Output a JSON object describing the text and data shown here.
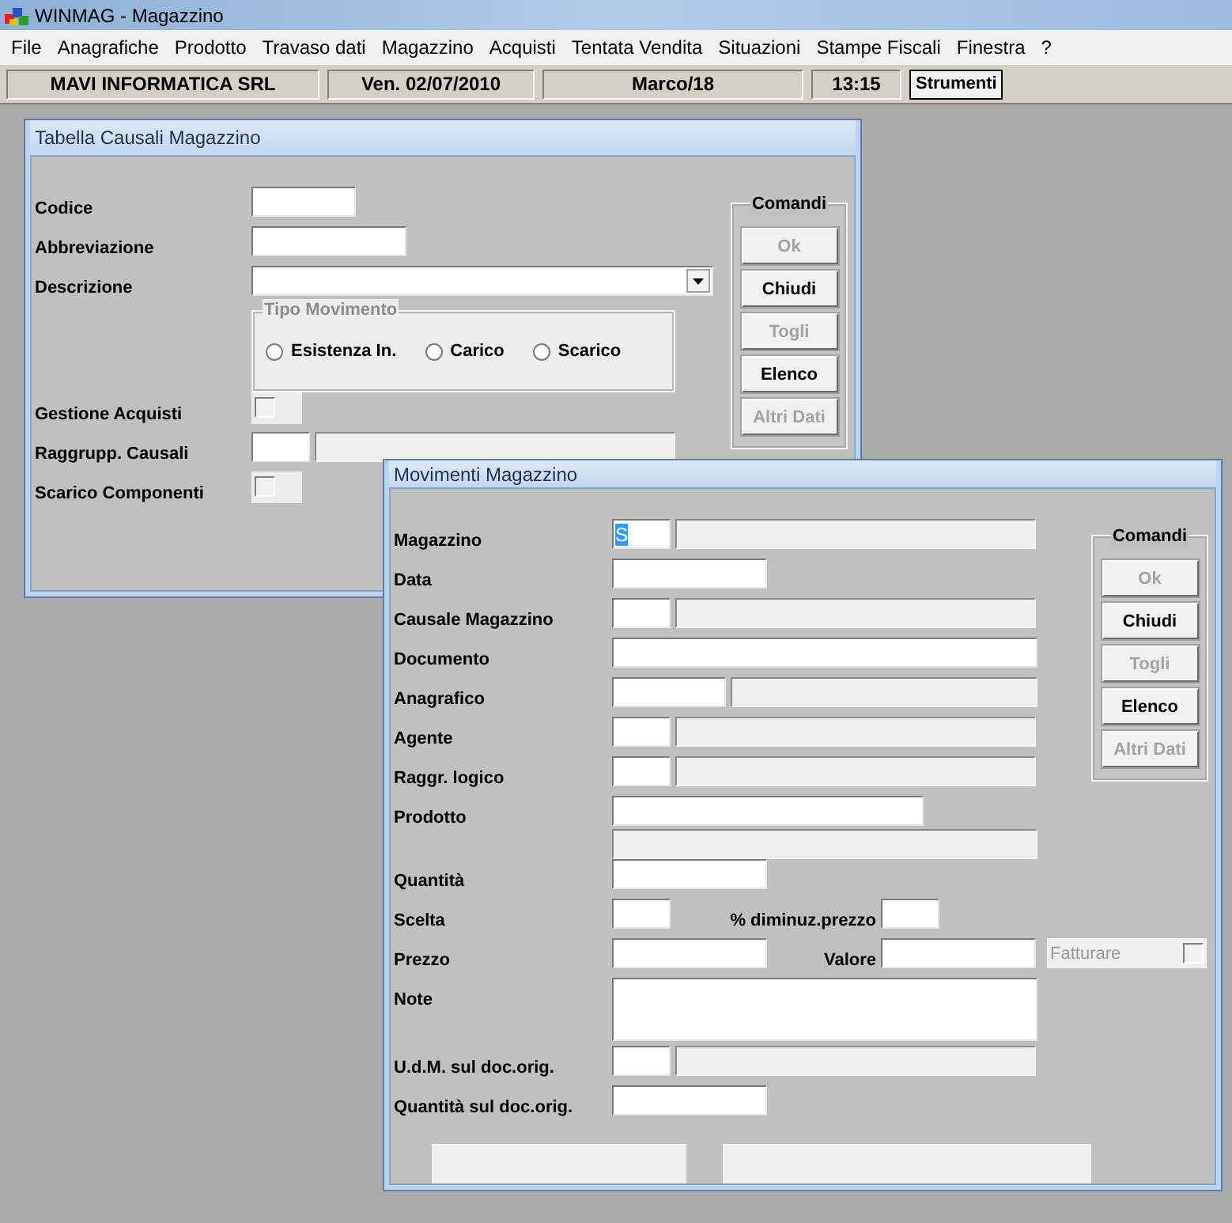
{
  "window": {
    "title": "WINMAG - Magazzino"
  },
  "menu": [
    "File",
    "Anagrafiche",
    "Prodotto",
    "Travaso dati",
    "Magazzino",
    "Acquisti",
    "Tentata Vendita",
    "Situazioni",
    "Stampe Fiscali",
    "Finestra",
    "?"
  ],
  "info_bar": [
    {
      "kind": "cell",
      "text": "MAVI INFORMATICA SRL"
    },
    {
      "kind": "cell",
      "text": "Ven. 02/07/2010"
    },
    {
      "kind": "cell",
      "text": "Marco/18"
    },
    {
      "kind": "cell",
      "text": "13:15"
    },
    {
      "kind": "button",
      "text": "Strumenti"
    }
  ],
  "dialogs": [
    {
      "title": "Tabella Causali Magazzino",
      "commands": {
        "title": "Comandi",
        "buttons": [
          {
            "label": "Ok",
            "disabled": true
          },
          {
            "label": "Chiudi",
            "disabled": false
          },
          {
            "label": "Togli",
            "disabled": true
          },
          {
            "label": "Elenco",
            "disabled": false
          },
          {
            "label": "Altri Dati",
            "disabled": true
          }
        ]
      },
      "fields": [
        {
          "kind": "short",
          "label": "Codice"
        },
        {
          "kind": "medium",
          "label": "Abbreviazione"
        },
        {
          "kind": "combo",
          "label": "Descrizione"
        },
        {
          "kind": "radios",
          "title": "Tipo Movimento",
          "options": [
            {
              "label": "Esistenza In.",
              "selected": false
            },
            {
              "label": "Carico",
              "selected": false
            },
            {
              "label": "Scarico",
              "selected": false
            }
          ]
        },
        {
          "kind": "check",
          "label": "Gestione Acquisti",
          "checked": false
        },
        {
          "kind": "code_desc",
          "label": "Raggrupp. Causali"
        },
        {
          "kind": "check",
          "label": "Scarico Componenti",
          "checked": false
        }
      ]
    },
    {
      "title": "Movimenti Magazzino",
      "commands": {
        "title": "Comandi",
        "buttons": [
          {
            "label": "Ok",
            "disabled": true
          },
          {
            "label": "Chiudi",
            "disabled": false
          },
          {
            "label": "Togli",
            "disabled": true
          },
          {
            "label": "Elenco",
            "disabled": false
          },
          {
            "label": "Altri Dati",
            "disabled": true
          }
        ]
      },
      "fields": [
        {
          "kind": "code_desc",
          "label": "Magazzino",
          "value": "S",
          "value_selected": true
        },
        {
          "kind": "medium",
          "label": "Data"
        },
        {
          "kind": "code_desc",
          "label": "Causale Magazzino"
        },
        {
          "kind": "long",
          "label": "Documento"
        },
        {
          "kind": "wide_code_desc",
          "label": "Anagrafico"
        },
        {
          "kind": "code_desc",
          "label": "Agente"
        },
        {
          "kind": "code_desc",
          "label": "Raggr. logico"
        },
        {
          "kind": "product",
          "label": "Prodotto"
        },
        {
          "kind": "medium",
          "label": "Quantità"
        },
        {
          "kind": "pair_short",
          "label": "Scelta",
          "second_label": "% diminuz.prezzo"
        },
        {
          "kind": "pair_medium",
          "label": "Prezzo",
          "second_label": "Valore",
          "option": {
            "label": "Fatturare",
            "checked": false,
            "disabled": true
          }
        },
        {
          "kind": "note",
          "label": "Note"
        },
        {
          "kind": "code_desc",
          "label": "U.d.M. sul doc.orig."
        },
        {
          "kind": "medium",
          "label": "Quantità sul doc.orig."
        }
      ],
      "footer_panels": true
    }
  ]
}
